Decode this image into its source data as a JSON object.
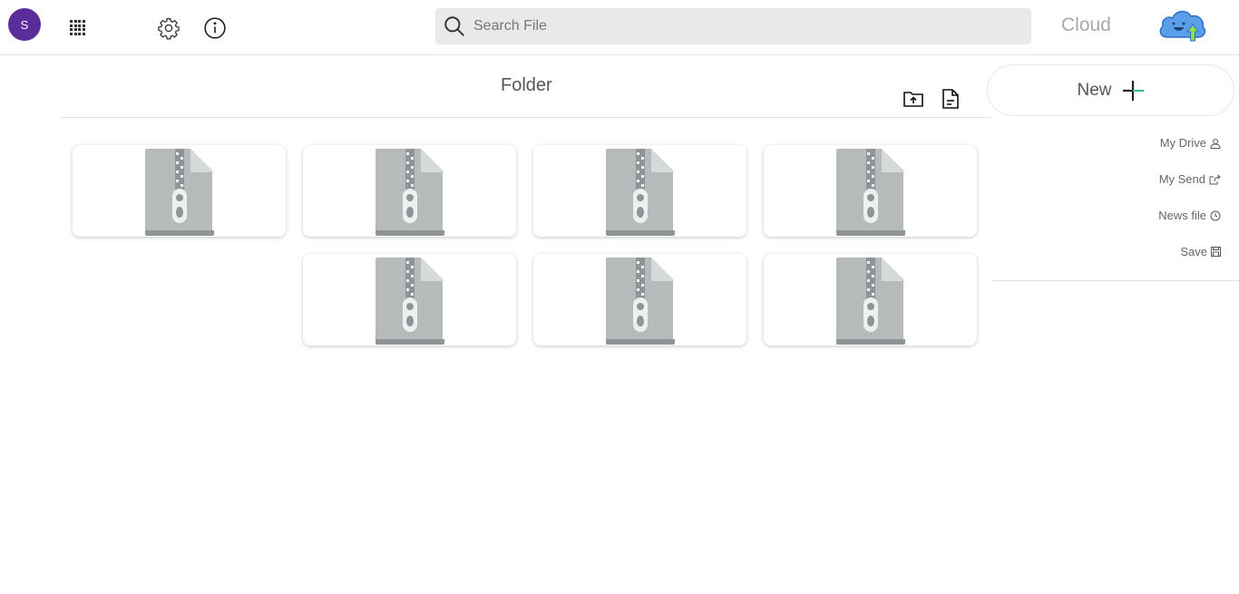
{
  "header": {
    "avatar_letter": "S",
    "search_placeholder": "Search File",
    "brand": "Cloud"
  },
  "folder": {
    "title": "Folder"
  },
  "files": [
    {
      "icon": "zip-file-icon"
    },
    {
      "icon": "zip-file-icon"
    },
    {
      "icon": "zip-file-icon"
    },
    {
      "icon": "zip-file-icon"
    },
    {
      "icon": "zip-file-icon"
    },
    {
      "icon": "zip-file-icon"
    },
    {
      "icon": "zip-file-icon"
    }
  ],
  "sidebar": {
    "new_label": "New",
    "items": [
      {
        "label": "My Drive",
        "icon": "user-icon"
      },
      {
        "label": "My Send",
        "icon": "share-icon"
      },
      {
        "label": "News file",
        "icon": "clock-icon"
      },
      {
        "label": "Save",
        "icon": "save-icon"
      }
    ]
  },
  "colors": {
    "avatar": "#5b2d9b",
    "plus_accent": "#2ec27e",
    "search_bg": "#e9e9e9",
    "zip_gray": "#b6babb"
  }
}
